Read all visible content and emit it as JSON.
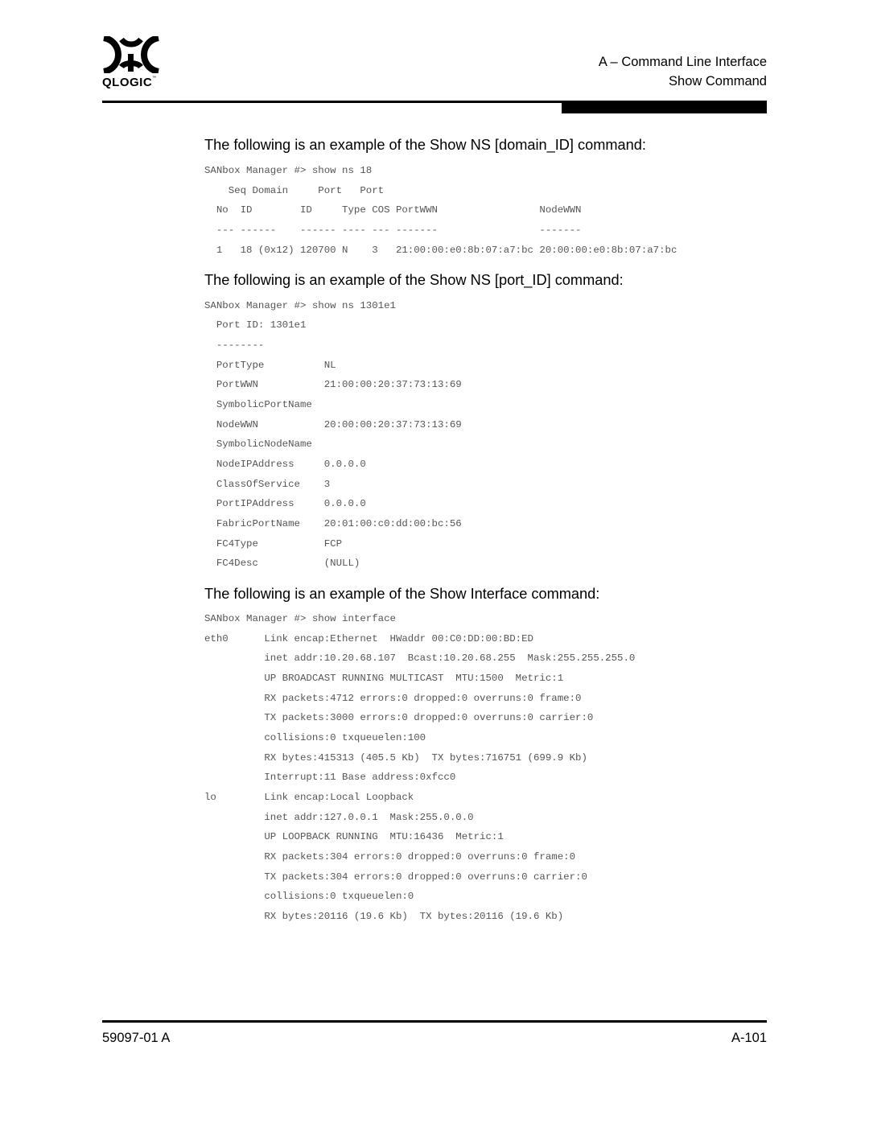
{
  "header": {
    "logo_text": "QLOGIC",
    "logo_tm": "™",
    "chapter": "A – Command Line Interface",
    "section": "Show Command"
  },
  "sections": [
    {
      "heading": "The following is an example of the Show NS [domain_ID] command:",
      "lines": [
        "SANbox Manager #> show ns 18",
        "    Seq Domain     Port   Port",
        "  No  ID        ID     Type COS PortWWN                 NodeWWN",
        "  --- ------    ------ ---- --- -------                 -------",
        "  1   18 (0x12) 120700 N    3   21:00:00:e0:8b:07:a7:bc 20:00:00:e0:8b:07:a7:bc"
      ]
    },
    {
      "heading": "The following is an example of the Show NS [port_ID] command:",
      "lines": [
        "SANbox Manager #> show ns 1301e1",
        "  Port ID: 1301e1",
        "  --------",
        "  PortType          NL",
        "  PortWWN           21:00:00:20:37:73:13:69",
        "  SymbolicPortName",
        "  NodeWWN           20:00:00:20:37:73:13:69",
        "  SymbolicNodeName",
        "  NodeIPAddress     0.0.0.0",
        "  ClassOfService    3",
        "  PortIPAddress     0.0.0.0",
        "  FabricPortName    20:01:00:c0:dd:00:bc:56",
        "  FC4Type           FCP",
        "  FC4Desc           (NULL)"
      ]
    },
    {
      "heading": "The following is an example of the Show Interface command:",
      "lines": [
        "SANbox Manager #> show interface",
        "eth0      Link encap:Ethernet  HWaddr 00:C0:DD:00:BD:ED",
        "          inet addr:10.20.68.107  Bcast:10.20.68.255  Mask:255.255.255.0",
        "          UP BROADCAST RUNNING MULTICAST  MTU:1500  Metric:1",
        "          RX packets:4712 errors:0 dropped:0 overruns:0 frame:0",
        "          TX packets:3000 errors:0 dropped:0 overruns:0 carrier:0",
        "          collisions:0 txqueuelen:100",
        "          RX bytes:415313 (405.5 Kb)  TX bytes:716751 (699.9 Kb)",
        "          Interrupt:11 Base address:0xfcc0",
        "lo        Link encap:Local Loopback",
        "          inet addr:127.0.0.1  Mask:255.0.0.0",
        "          UP LOOPBACK RUNNING  MTU:16436  Metric:1",
        "          RX packets:304 errors:0 dropped:0 overruns:0 frame:0",
        "          TX packets:304 errors:0 dropped:0 overruns:0 carrier:0",
        "          collisions:0 txqueuelen:0",
        "          RX bytes:20116 (19.6 Kb)  TX bytes:20116 (19.6 Kb)"
      ]
    }
  ],
  "footer": {
    "doc_number": "59097-01 A",
    "page_number": "A-101"
  }
}
